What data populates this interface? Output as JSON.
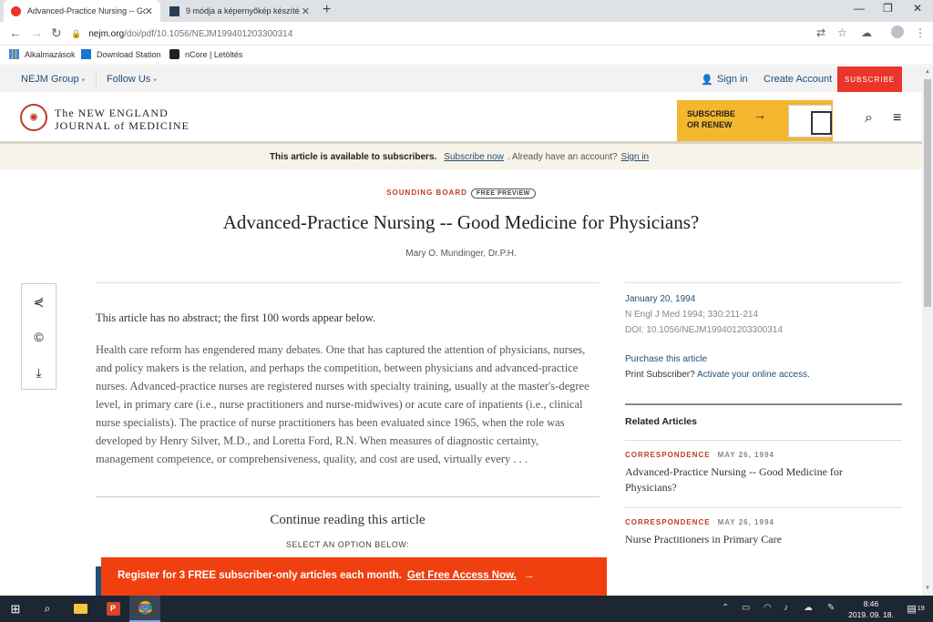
{
  "browser": {
    "tabs": [
      {
        "title": "Advanced-Practice Nursing -- Go",
        "active": true,
        "icon": "nejm-favicon"
      },
      {
        "title": "9 módja a képernyőkép készítés",
        "active": false,
        "icon": "article-favicon"
      }
    ],
    "new_tab_icon": "plus-icon",
    "url_host": "nejm.org",
    "url_path": "/doi/pdf/10.1056/NEJM199401203300314",
    "bookmarks": [
      {
        "label": "Alkalmazások",
        "icon": "apps-grid-icon"
      },
      {
        "label": "Download Station",
        "icon": "dsm-icon"
      },
      {
        "label": "nCore | Letöltés",
        "icon": "ncore-icon"
      }
    ]
  },
  "site": {
    "group_label": "NEJM Group",
    "follow_label": "Follow Us",
    "signin_label": "Sign in",
    "create_account_label": "Create Account",
    "subscribe_label": "SUBSCRIBE",
    "logo_line1": "The NEW ENGLAND",
    "logo_line2": "JOURNAL of MEDICINE",
    "promo_line1": "SUBSCRIBE",
    "promo_line2": "OR RENEW"
  },
  "availability": {
    "bold": "This article is available to subscribers.",
    "link1": "Subscribe now",
    "mid": ". Already have an account?",
    "link2": "Sign in"
  },
  "article": {
    "section": "SOUNDING BOARD",
    "badge": "FREE PREVIEW",
    "title": "Advanced-Practice Nursing -- Good Medicine for Physicians?",
    "author": "Mary O. Mundinger, Dr.P.H.",
    "no_abstract": "This article has no abstract; the first 100 words appear below.",
    "body": "Health care reform has engendered many debates. One that has captured the attention of physicians, nurses, and policy makers is the relation, and perhaps the competition, between physicians and advanced-practice nurses. Advanced-practice nurses are registered nurses with specialty training, usually at the master's-degree level, in primary care (i.e., nurse practitioners and nurse-midwives) or acute care of inpatients (i.e., clinical nurse specialists). The practice of nurse practitioners has been evaluated since 1965, when the role was developed by Henry Silver, M.D., and Loretta Ford, R.N. When measures of diagnostic certainty, management competence, or comprehensiveness, quality, and cost are used, virtually every . . .",
    "continue": "Continue reading this article",
    "select": "SELECT AN OPTION BELOW:",
    "register_text": "Register for 3 FREE subscriber-only articles each month.",
    "register_link": "Get Free Access Now."
  },
  "sidebar": {
    "date": "January 20, 1994",
    "citation": "N Engl J Med 1994; 330:211-214",
    "doi": "DOI: 10.1056/NEJM199401203300314",
    "purchase": "Purchase this article",
    "print_prefix": "Print Subscriber?",
    "print_link": "Activate your online access.",
    "related_heading": "Related Articles",
    "related": [
      {
        "kind": "CORRESPONDENCE",
        "date": "MAY 26, 1994",
        "title": "Advanced-Practice Nursing -- Good Medicine for Physicians?"
      },
      {
        "kind": "CORRESPONDENCE",
        "date": "MAY 26, 1994",
        "title": "Nurse Practitioners in Primary Care"
      }
    ]
  },
  "taskbar": {
    "time": "8:46",
    "date": "2019. 09. 18.",
    "notif_count": "19"
  },
  "colors": {
    "accent_red": "#e9352b",
    "nejm_blue": "#1f4e79",
    "promo_yellow": "#f4b72e",
    "register_orange": "#f0400f"
  }
}
